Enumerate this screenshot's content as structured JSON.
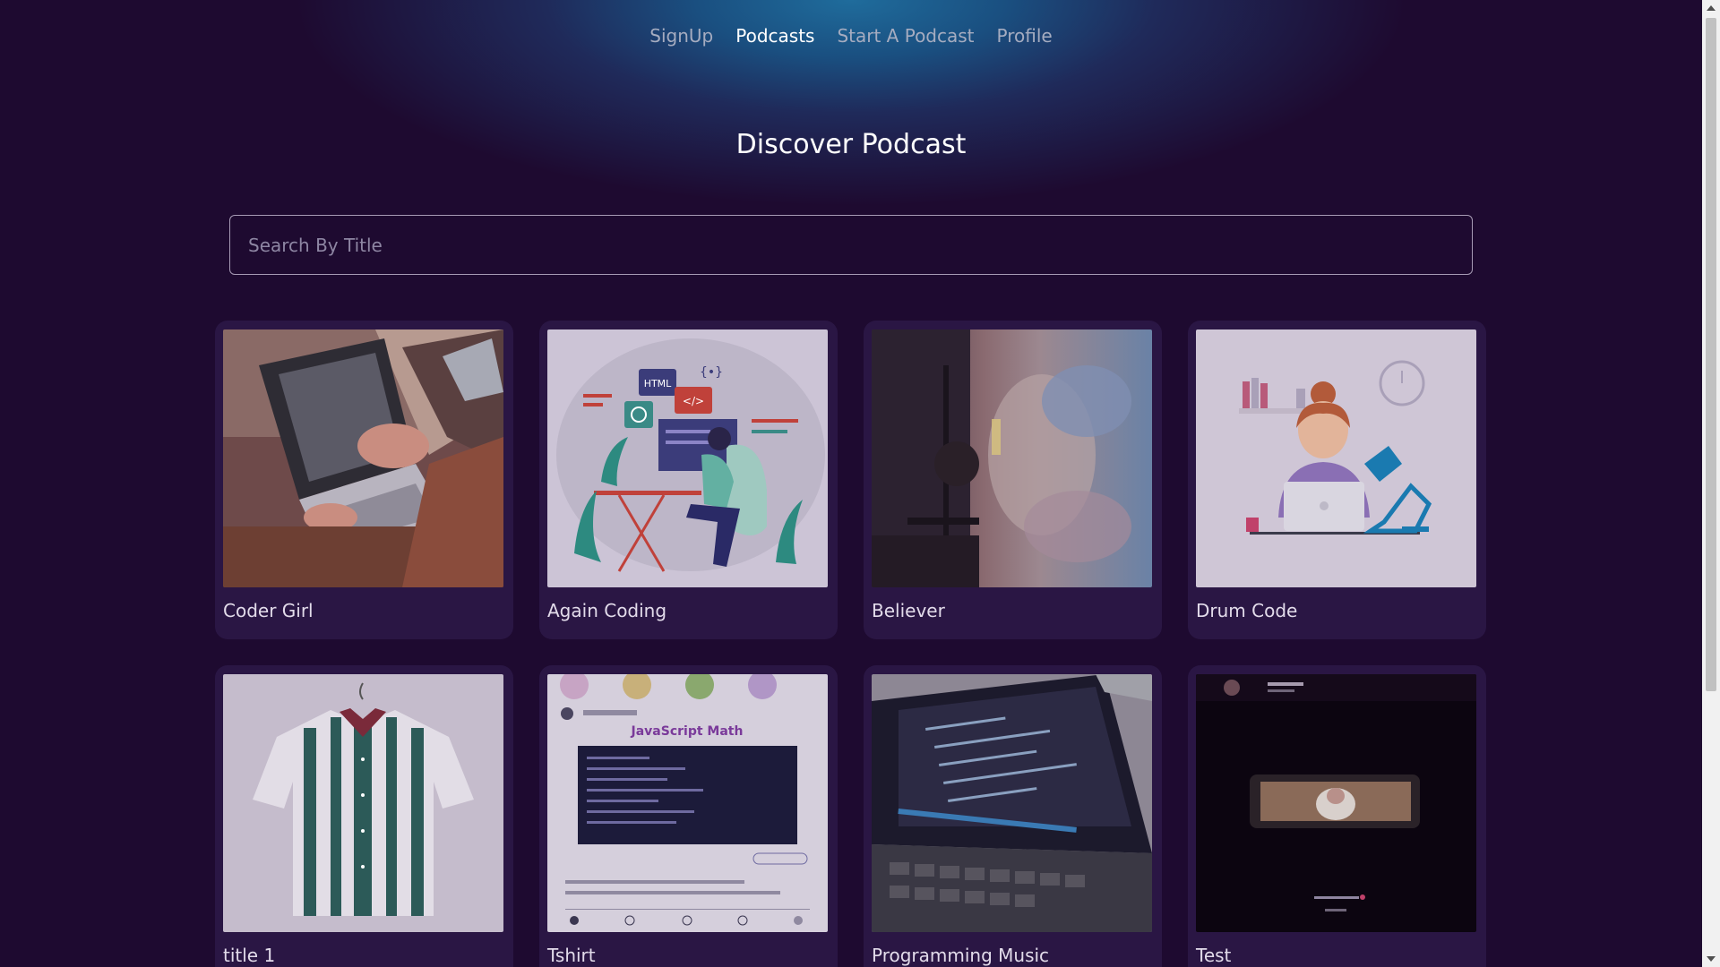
{
  "nav": {
    "items": [
      {
        "label": "SignUp",
        "active": false
      },
      {
        "label": "Podcasts",
        "active": true
      },
      {
        "label": "Start A Podcast",
        "active": false
      },
      {
        "label": "Profile",
        "active": false
      }
    ]
  },
  "page": {
    "title": "Discover Podcast"
  },
  "search": {
    "placeholder": "Search By Title",
    "value": ""
  },
  "podcasts": [
    {
      "title": "Coder Girl",
      "image": "people-typing-on-laptops-photo"
    },
    {
      "title": "Again Coding",
      "image": "developer-at-desk-illustration"
    },
    {
      "title": "Believer",
      "image": "sunset-sky-photo"
    },
    {
      "title": "Drum Code",
      "image": "woman-with-laptop-illustration"
    },
    {
      "title": "title 1",
      "image": "striped-shirt-photo"
    },
    {
      "title": "Tshirt",
      "image": "javascript-math-screenshot"
    },
    {
      "title": "Programming Music",
      "image": "laptop-code-screen-photo"
    },
    {
      "title": "Test",
      "image": "dark-video-screenshot"
    }
  ],
  "colors": {
    "background": "#1e0a30",
    "card": "#2a1644",
    "glow": "#1f6c9c",
    "nav_inactive": "#a5acc0"
  }
}
